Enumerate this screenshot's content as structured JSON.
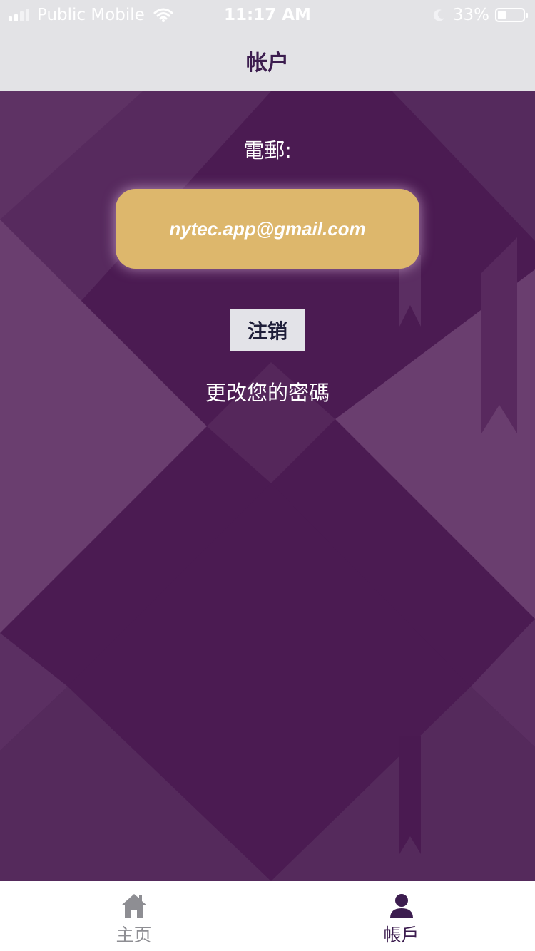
{
  "status_bar": {
    "carrier": "Public Mobile",
    "time": "11:17 AM",
    "battery": "33%",
    "icons": [
      "signal-icon",
      "wifi-icon",
      "moon-icon",
      "battery-icon"
    ]
  },
  "header": {
    "title": "帐户"
  },
  "account": {
    "email_label": "電郵:",
    "email_value": "nytec.app@gmail.com",
    "logout_label": "注销",
    "change_password_label": "更改您的密碼"
  },
  "tab_bar": {
    "tabs": [
      {
        "label": "主页",
        "icon": "home-icon",
        "active": false
      },
      {
        "label": "帳戶",
        "icon": "user-icon",
        "active": true
      }
    ]
  },
  "colors": {
    "background_purple": "#4b1b52",
    "accent_gold": "#ddb76c",
    "active_tab": "#3c1d4f",
    "inactive_tab": "#8e8e93"
  }
}
